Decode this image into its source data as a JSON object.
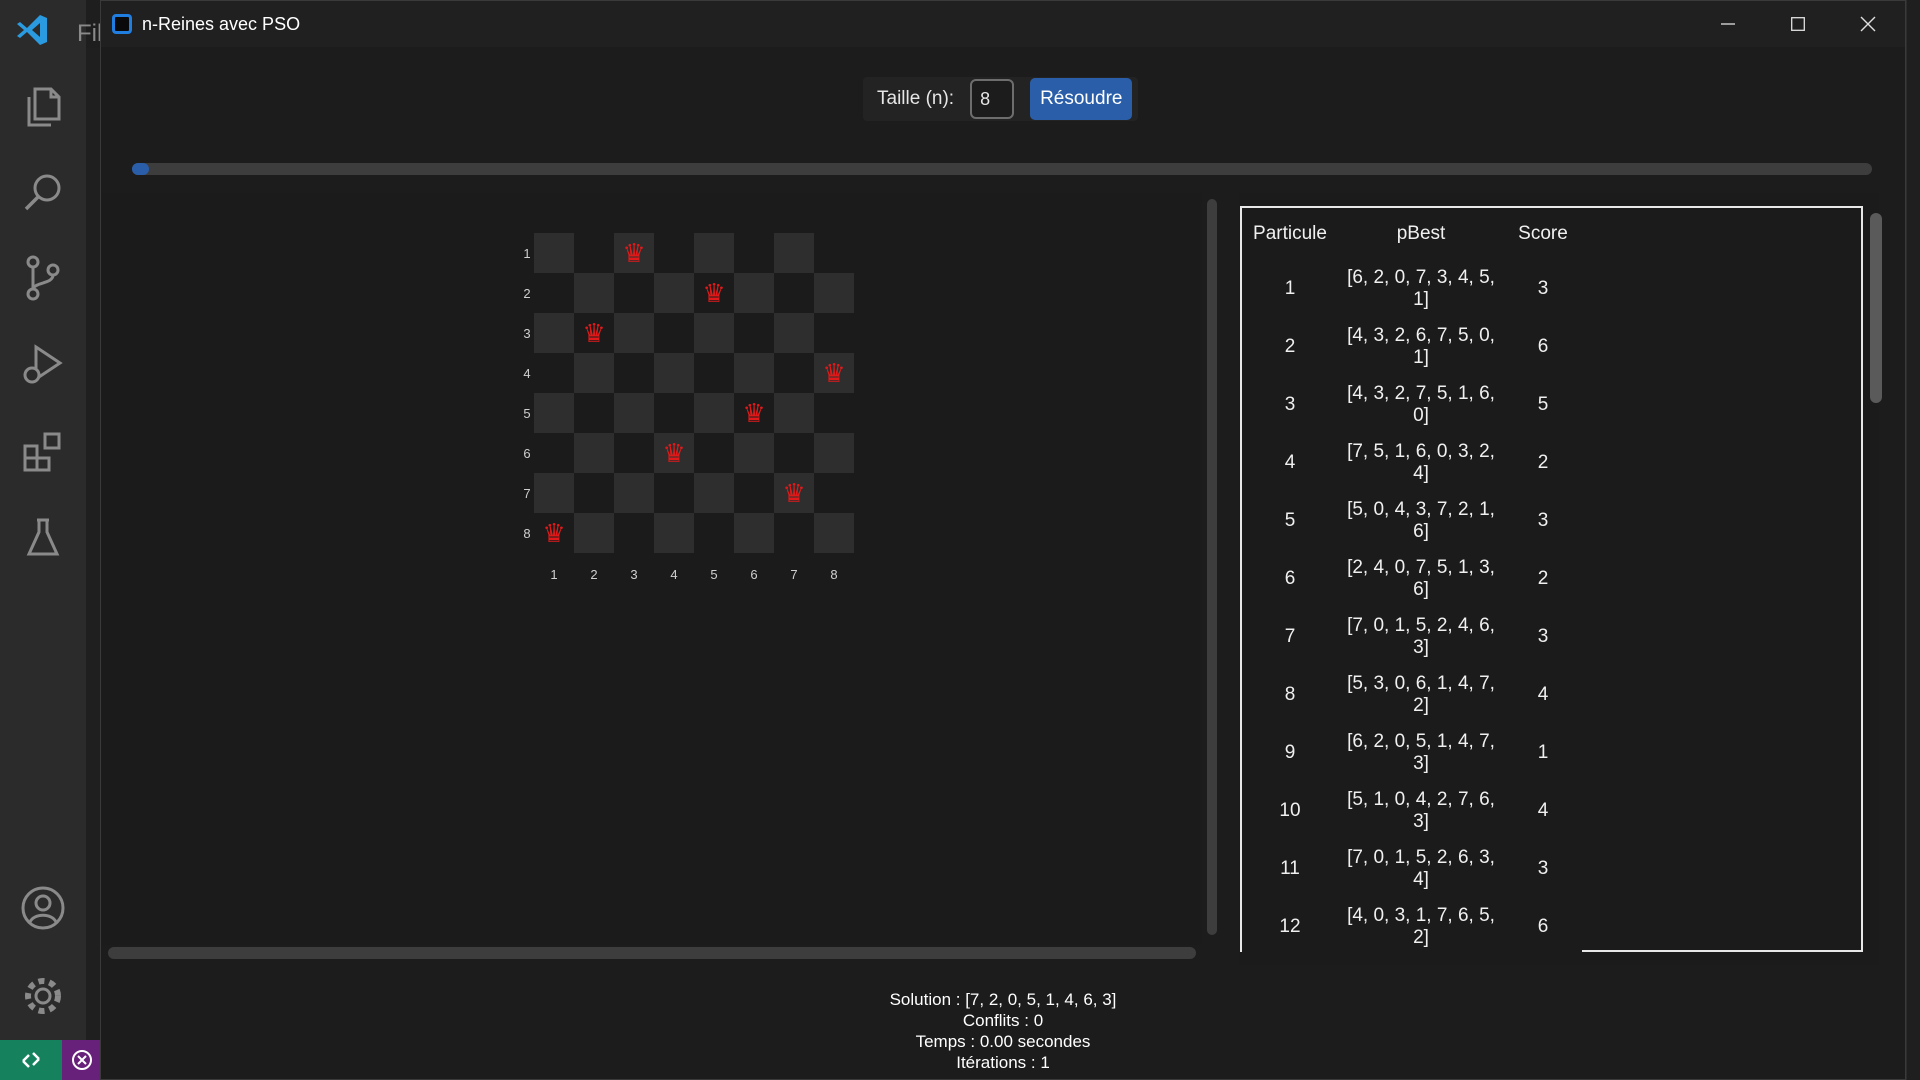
{
  "vscode": {
    "menu_peek": "Fil",
    "activity_icons": [
      "explorer-icon",
      "search-icon",
      "source-control-icon",
      "run-debug-icon",
      "extensions-icon",
      "testing-icon",
      "account-icon",
      "settings-gear-icon"
    ]
  },
  "window": {
    "title": "n-Reines avec PSO",
    "accent": "#2a5ea8"
  },
  "toolbar": {
    "size_label": "Taille (n):",
    "size_value": "8",
    "solve_label": "Résoudre"
  },
  "progress": {
    "fraction": 0.01
  },
  "board": {
    "n": 8,
    "row_labels": [
      "1",
      "2",
      "3",
      "4",
      "5",
      "6",
      "7",
      "8"
    ],
    "col_labels": [
      "1",
      "2",
      "3",
      "4",
      "5",
      "6",
      "7",
      "8"
    ],
    "queen_columns_by_row": [
      3,
      5,
      2,
      8,
      6,
      4,
      7,
      1
    ],
    "queen_glyph": "♛",
    "queen_color": "#e01a1a"
  },
  "table": {
    "headers": [
      "Particule",
      "pBest",
      "Score"
    ],
    "rows": [
      [
        "1",
        "[6, 2, 0, 7, 3, 4, 5, 1]",
        "3"
      ],
      [
        "2",
        "[4, 3, 2, 6, 7, 5, 0, 1]",
        "6"
      ],
      [
        "3",
        "[4, 3, 2, 7, 5, 1, 6, 0]",
        "5"
      ],
      [
        "4",
        "[7, 5, 1, 6, 0, 3, 2, 4]",
        "2"
      ],
      [
        "5",
        "[5, 0, 4, 3, 7, 2, 1, 6]",
        "3"
      ],
      [
        "6",
        "[2, 4, 0, 7, 5, 1, 3, 6]",
        "2"
      ],
      [
        "7",
        "[7, 0, 1, 5, 2, 4, 6, 3]",
        "3"
      ],
      [
        "8",
        "[5, 3, 0, 6, 1, 4, 7, 2]",
        "4"
      ],
      [
        "9",
        "[6, 2, 0, 5, 1, 4, 7, 3]",
        "1"
      ],
      [
        "10",
        "[5, 1, 0, 4, 2, 7, 6, 3]",
        "4"
      ],
      [
        "11",
        "[7, 0, 1, 5, 2, 6, 3, 4]",
        "3"
      ],
      [
        "12",
        "[4, 0, 3, 1, 7, 6, 5, 2]",
        "6"
      ]
    ]
  },
  "results": {
    "solution": "Solution : [7, 2, 0, 5, 1, 4, 6, 3]",
    "conflicts": "Conflits : 0",
    "time": "Temps : 0.00 secondes",
    "iterations": "Itérations : 1"
  }
}
